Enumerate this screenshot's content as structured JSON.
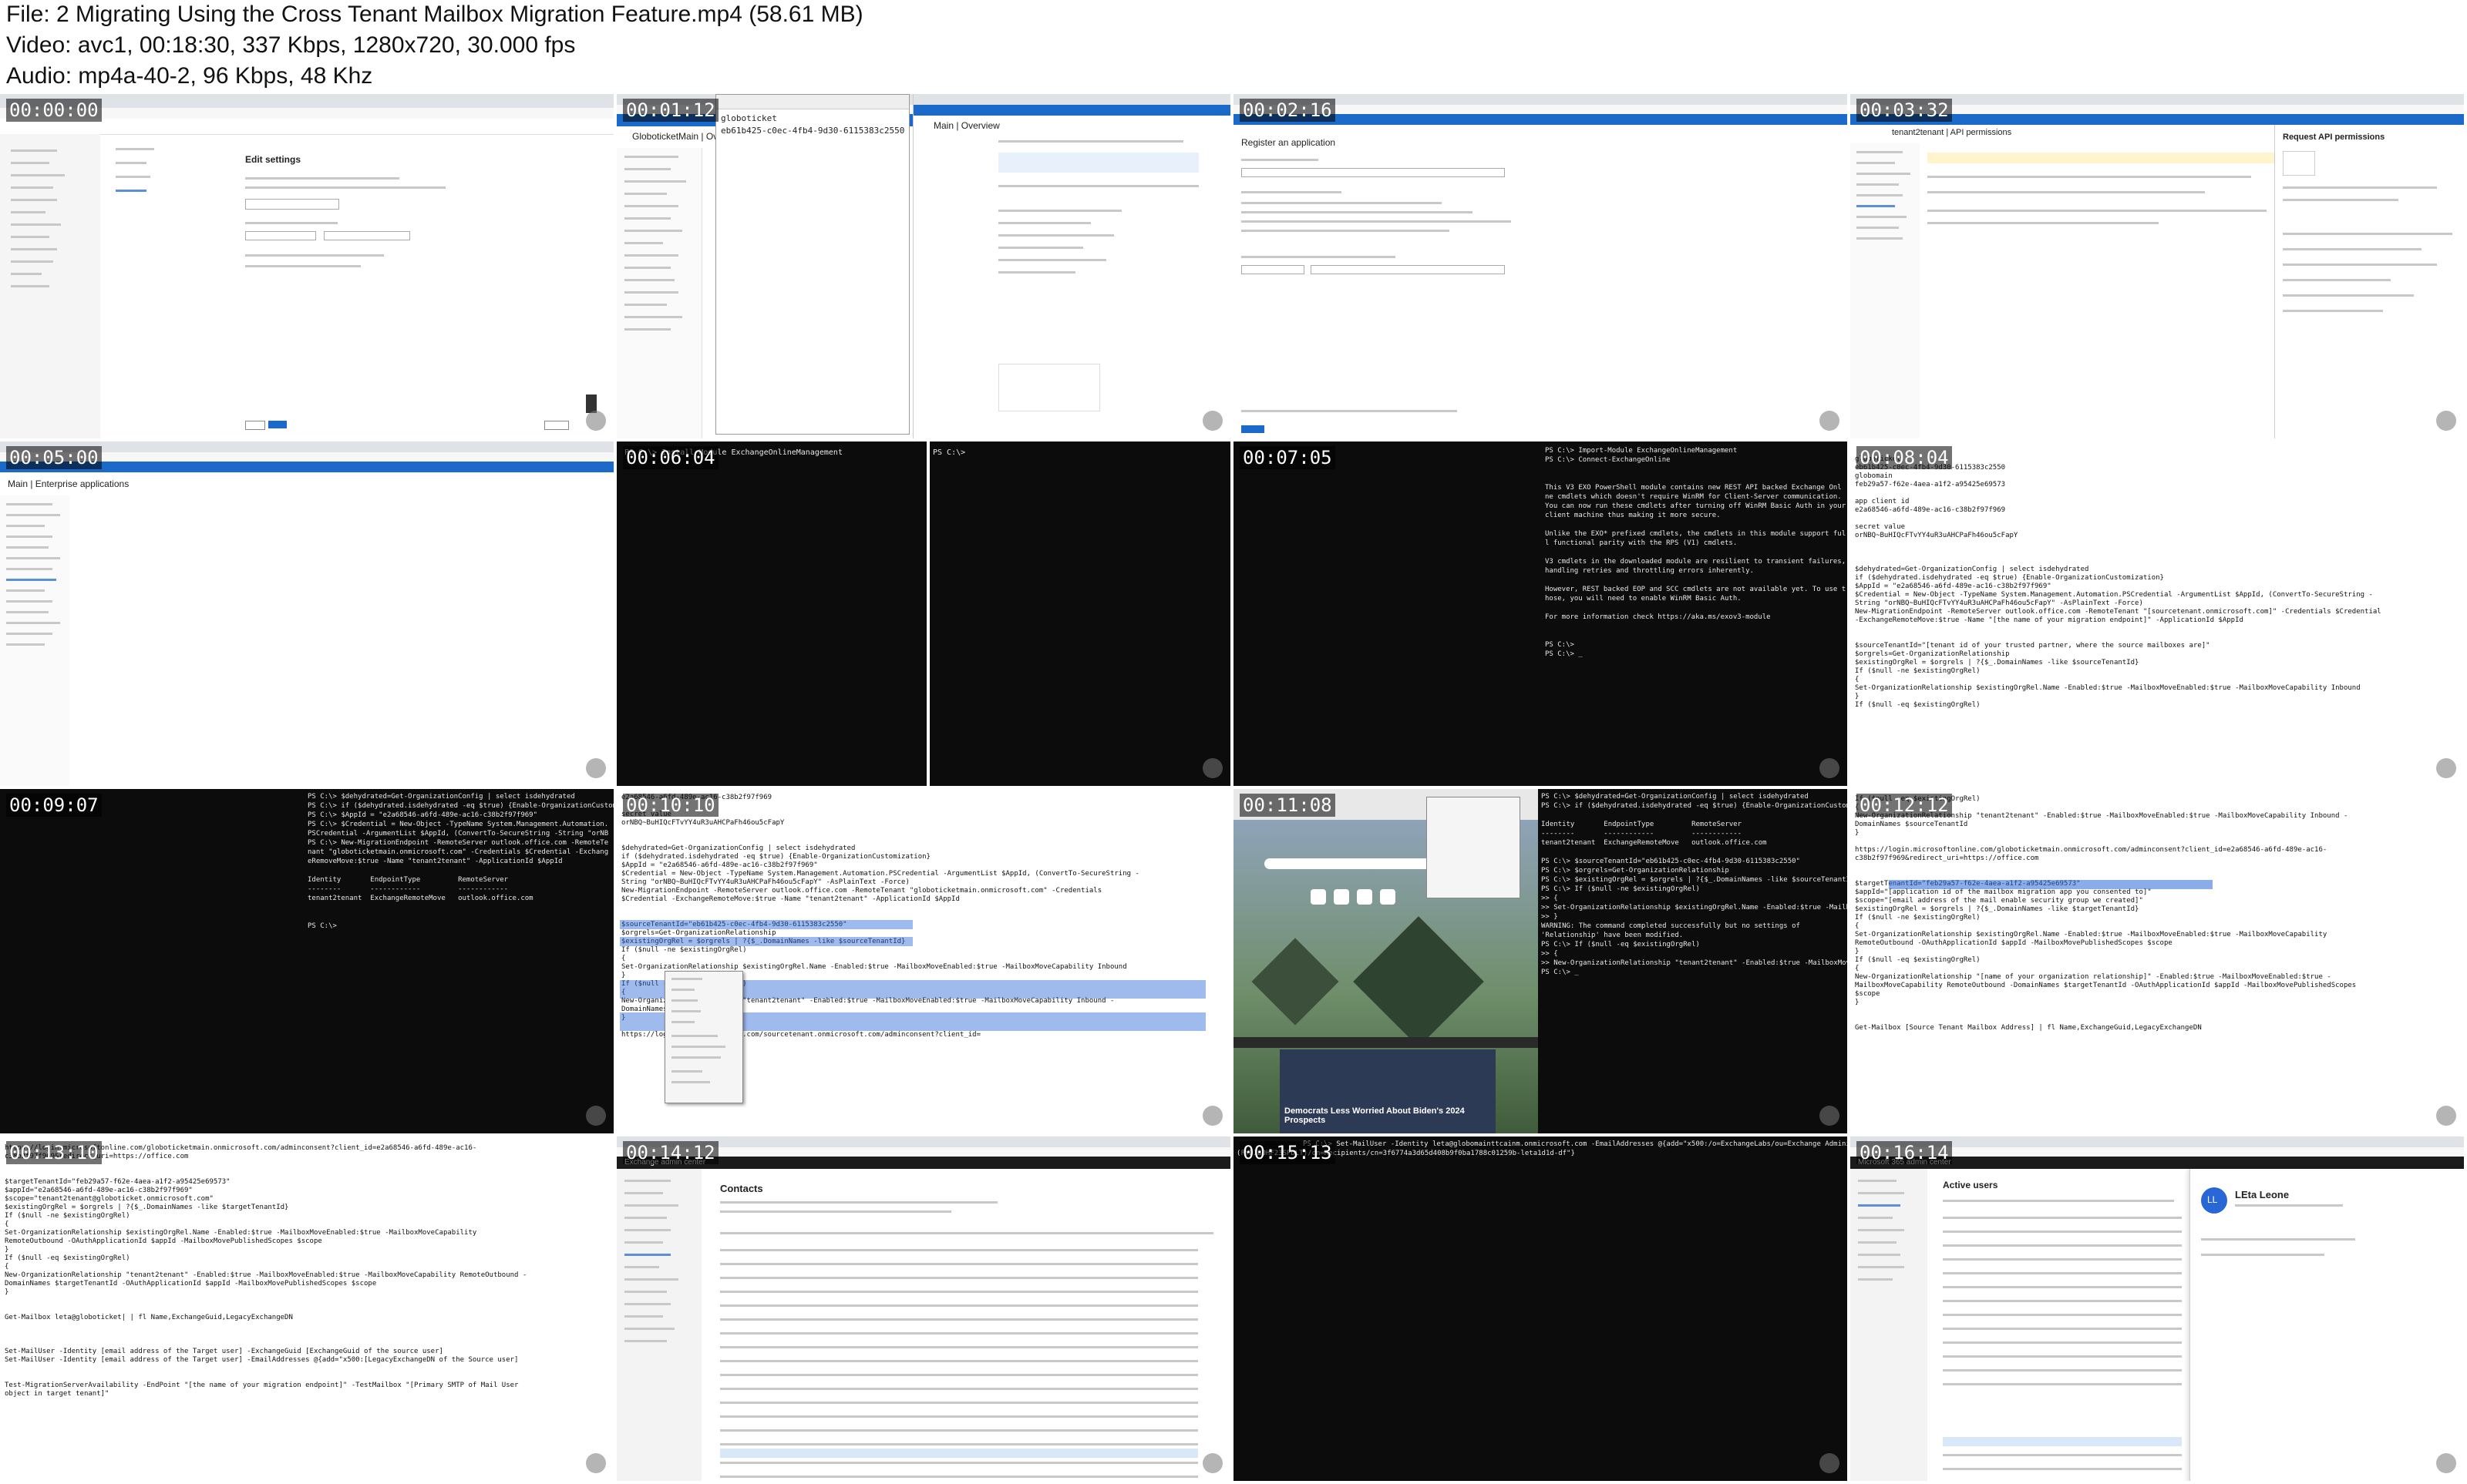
{
  "header": {
    "file_line": "File: 2  Migrating Using the Cross Tenant Mailbox Migration Feature.mp4 (58.61 MB)",
    "video_line": "Video: avc1, 00:18:30, 337 Kbps, 1280x720, 30.000 fps",
    "audio_line": "Audio: mp4a-40-2, 96 Kbps, 48 Khz"
  },
  "thumbnails": [
    {
      "time": "00:00:00"
    },
    {
      "time": "00:01:12"
    },
    {
      "time": "00:02:16"
    },
    {
      "time": "00:03:32"
    },
    {
      "time": "00:05:00"
    },
    {
      "time": "00:06:04"
    },
    {
      "time": "00:07:05"
    },
    {
      "time": "00:08:04"
    },
    {
      "time": "00:09:07"
    },
    {
      "time": "00:10:10"
    },
    {
      "time": "00:11:08"
    },
    {
      "time": "00:12:12"
    },
    {
      "time": "00:13:10"
    },
    {
      "time": "00:14:12"
    },
    {
      "time": "00:15:13"
    },
    {
      "time": "00:16:14"
    }
  ],
  "t1": {
    "page_title": "Edit settings"
  },
  "t2": {
    "app_name": "GloboticketMain | Ov",
    "notepad_title": "globoticket",
    "notepad_id": "eb61b425-c0ec-4fb4-9d30-6115383c2550",
    "overview_title": "Main | Overview"
  },
  "t3": {
    "page_title": "Register an application"
  },
  "t4": {
    "breadcrumb": "tenant2tenant | API permissions",
    "panel_title": "Request API permissions"
  },
  "t5": {
    "page_title": "Main | Enterprise applications"
  },
  "t6": {
    "cmd": "PS C:\\> Install-Module ExchangeOnlineManagement",
    "prompt": "PS C:\\>"
  },
  "t7": {
    "lines": [
      "PS C:\\> Import-Module ExchangeOnlineManagement",
      "PS C:\\> Connect-ExchangeOnline",
      "",
      "",
      "This V3 EXO PowerShell module contains new REST API backed Exchange Onl",
      "ne cmdlets which doesn't require WinRM for Client-Server communication.",
      "You can now run these cmdlets after turning off WinRM Basic Auth in your",
      "client machine thus making it more secure.",
      "",
      "Unlike the EXO* prefixed cmdlets, the cmdlets in this module support ful",
      "l functional parity with the RPS (V1) cmdlets.",
      "",
      "V3 cmdlets in the downloaded module are resilient to transient failures,",
      "handling retries and throttling errors inherently.",
      "",
      "However, REST backed EOP and SCC cmdlets are not available yet. To use t",
      "hose, you will need to enable WinRM Basic Auth.",
      "",
      "For more information check https://aka.ms/exov3-module",
      "",
      "",
      "PS C:\\>",
      "PS C:\\> _"
    ]
  },
  "t8": {
    "lines": [
      "globoticket",
      "eb61b425-c0ec-4fb4-9d30-6115383c2550",
      "globomain",
      "feb29a57-f62e-4aea-a1f2-a95425e69573",
      "",
      "app client id",
      "e2a68546-a6fd-489e-ac16-c38b2f97f969",
      "",
      "secret value",
      "orNBQ~BuHIQcFTvYY4uR3uAHCPaFh46ou5cFapY",
      "",
      "",
      "",
      "$dehydrated=Get-OrganizationConfig | select isdehydrated",
      "if ($dehydrated.isdehydrated -eq $true) {Enable-OrganizationCustomization}",
      "$AppId = \"e2a68546-a6fd-489e-ac16-c38b2f97f969\"",
      "$Credential = New-Object -TypeName System.Management.Automation.PSCredential -ArgumentList $AppId, (ConvertTo-SecureString -",
      "String \"orNBQ~BuHIQcFTvYY4uR3uAHCPaFh46ou5cFapY\" -AsPlainText -Force)",
      "New-MigrationEndpoint -RemoteServer outlook.office.com -RemoteTenant \"[sourcetenant.onmicrosoft.com]\" -Credentials $Credential",
      "-ExchangeRemoteMove:$true -Name \"[the name of your migration endpoint]\" -ApplicationId $AppId",
      "",
      "",
      "$sourceTenantId=\"[tenant id of your trusted partner, where the source mailboxes are]\"",
      "$orgrels=Get-OrganizationRelationship",
      "$existingOrgRel = $orgrels | ?{$_.DomainNames -like $sourceTenantId}",
      "If ($null -ne $existingOrgRel)",
      "{",
      "Set-OrganizationRelationship $existingOrgRel.Name -Enabled:$true -MailboxMoveEnabled:$true -MailboxMoveCapability Inbound",
      "}",
      "If ($null -eq $existingOrgRel)"
    ]
  },
  "t9": {
    "lines": [
      "PS C:\\> $dehydrated=Get-OrganizationConfig | select isdehydrated",
      "PS C:\\> if ($dehydrated.isdehydrated -eq $true) {Enable-OrganizationCustomization}",
      "PS C:\\> $AppId = \"e2a68546-a6fd-489e-ac16-c38b2f97f969\"",
      "PS C:\\> $Credential = New-Object -TypeName System.Management.Automation.",
      "PSCredential -ArgumentList $AppId, (ConvertTo-SecureString -String \"orNB",
      "PS C:\\> New-MigrationEndpoint -RemoteServer outlook.office.com -RemoteTe",
      "nant \"globoticketmain.onmicrosoft.com\" -Credentials $Credential -Exchang",
      "eRemoveMove:$true -Name \"tenant2tenant\" -ApplicationId $AppId",
      "",
      "Identity       EndpointType         RemoteServer",
      "--------       ------------         ------------",
      "tenant2tenant  ExchangeRemoteMove   outlook.office.com",
      "",
      "",
      "PS C:\\>"
    ]
  },
  "t10": {
    "lines": [
      "e2a68546-a6fd-489e-ac16-c38b2f97f969",
      "",
      "secret value",
      "orNBQ~BuHIQcFTvYY4uR3uAHCPaFh46ou5cFapY",
      "",
      "",
      "$dehydrated=Get-OrganizationConfig | select isdehydrated",
      "if ($dehydrated.isdehydrated -eq $true) {Enable-OrganizationCustomization}",
      "$AppId = \"e2a68546-a6fd-489e-ac16-c38b2f97f969\"",
      "$Credential = New-Object -TypeName System.Management.Automation.PSCredential -ArgumentList $AppId, (ConvertTo-SecureString -",
      "String \"orNBQ~BuHIQcFTvYY4uR3uAHCPaFh46ou5cFapY\" -AsPlainText -Force)",
      "New-MigrationEndpoint -RemoteServer outlook.office.com -RemoteTenant \"globoticketmain.onmicrosoft.com\" -Credentials",
      "$Credential -ExchangeRemoteMove:$true -Name \"tenant2tenant\" -ApplicationId $AppId",
      "",
      "",
      "$sourceTenantId=\"eb61b425-c0ec-4fb4-9d30-6115383c2550\"",
      "$orgrels=Get-OrganizationRelationship",
      "$existingOrgRel = $orgrels | ?{$_.DomainNames -like $sourceTenantId}",
      "If ($null -ne $existingOrgRel)",
      "{",
      "Set-OrganizationRelationship $existingOrgRel.Name -Enabled:$true -MailboxMoveEnabled:$true -MailboxMoveCapability Inbound",
      "}",
      "If ($null -eq $existingOrgRel)",
      "{",
      "New-OrganizationRelationship \"tenant2tenant\" -Enabled:$true -MailboxMoveEnabled:$true -MailboxMoveCapability Inbound -",
      "DomainNames $sourceTenantId",
      "}",
      "",
      "https://login.microsoftonline.com/sourcetenant.onmicrosoft.com/adminconsent?client_id="
    ]
  },
  "t11": {
    "news_headline": "Democrats Less Worried About Biden's 2024 Prospects",
    "lines": [
      "PS C:\\> $dehydrated=Get-OrganizationConfig | select isdehydrated",
      "PS C:\\> if ($dehydrated.isdehydrated -eq $true) {Enable-OrganizationCustomization}",
      "",
      "Identity       EndpointType         RemoteServer",
      "--------       ------------         ------------",
      "tenant2tenant  ExchangeRemoteMove   outlook.office.com",
      "",
      "PS C:\\> $sourceTenantId=\"eb61b425-c0ec-4fb4-9d30-6115383c2550\"",
      "PS C:\\> $orgrels=Get-OrganizationRelationship",
      "PS C:\\> $existingOrgRel = $orgrels | ?{$_.DomainNames -like $sourceTenantId}",
      "PS C:\\> If ($null -ne $existingOrgRel)",
      ">> {",
      ">> Set-OrganizationRelationship $existingOrgRel.Name -Enabled:$true -MailboxMove",
      ">> }",
      "WARNING: The command completed successfully but no settings of",
      "'Relationship' have been modified.",
      "PS C:\\> If ($null -eq $existingOrgRel)",
      ">> {",
      ">> New-OrganizationRelationship \"tenant2tenant\" -Enabled:$true -MailboxMove",
      "PS C:\\> _"
    ]
  },
  "t12": {
    "lines": [
      "If ($null -eq $existingOrgRel)",
      "{",
      "New-OrganizationRelationship \"tenant2tenant\" -Enabled:$true -MailboxMoveEnabled:$true -MailboxMoveCapability Inbound -",
      "DomainNames $sourceTenantId",
      "}",
      "",
      "https://login.microsoftonline.com/globoticketmain.onmicrosoft.com/adminconsent?client_id=e2a68546-a6fd-489e-ac16-",
      "c38b2f97f969&redirect_uri=https://office.com",
      "",
      "",
      "$targetTenantId=\"feb29a57-f62e-4aea-a1f2-a95425e69573\"",
      "$appId=\"[application id of the mailbox migration app you consented to]\"",
      "$scope=\"[email address of the mail enable security group we created]\"",
      "$existingOrgRel = $orgrels | ?{$_.DomainNames -like $targetTenantId}",
      "If ($null -ne $existingOrgRel)",
      "{",
      "Set-OrganizationRelationship $existingOrgRel.Name -Enabled:$true -MailboxMoveEnabled:$true -MailboxMoveCapability",
      "RemoteOutbound -OAuthApplicationId $appId -MailboxMovePublishedScopes $scope",
      "}",
      "If ($null -eq $existingOrgRel)",
      "{",
      "New-OrganizationRelationship \"[name of your organization relationship]\" -Enabled:$true -MailboxMoveEnabled:$true -",
      "MailboxMoveCapability RemoteOutbound -DomainNames $targetTenantId -OAuthApplicationId $appId -MailboxMovePublishedScopes",
      "$scope",
      "}",
      "",
      "",
      "Get-Mailbox [Source Tenant Mailbox Address] | fl Name,ExchangeGuid,LegacyExchangeDN"
    ]
  },
  "t13": {
    "lines": [
      "https://login.microsoftonline.com/globoticketmain.onmicrosoft.com/adminconsent?client_id=e2a68546-a6fd-489e-ac16-",
      "c38b2f97f969&redirect_uri=https://office.com",
      "",
      "",
      "$targetTenantId=\"feb29a57-f62e-4aea-a1f2-a95425e69573\"",
      "$appId=\"e2a68546-a6fd-489e-ac16-c38b2f97f969\"",
      "$scope=\"tenant2tenant@globoticket.onmicrosoft.com\"",
      "$existingOrgRel = $orgrels | ?{$_.DomainNames -like $targetTenantId}",
      "If ($null -ne $existingOrgRel)",
      "{",
      "Set-OrganizationRelationship $existingOrgRel.Name -Enabled:$true -MailboxMoveEnabled:$true -MailboxMoveCapability",
      "RemoteOutbound -OAuthApplicationId $appId -MailboxMovePublishedScopes $scope",
      "}",
      "If ($null -eq $existingOrgRel)",
      "{",
      "New-OrganizationRelationship \"tenant2tenant\" -Enabled:$true -MailboxMoveEnabled:$true -MailboxMoveCapability RemoteOutbound -",
      "DomainNames $targetTenantId -OAuthApplicationId $appId -MailboxMovePublishedScopes $scope",
      "}",
      "",
      "",
      "Get-Mailbox leta@globoticket| | fl Name,ExchangeGuid,LegacyExchangeDN",
      "",
      "",
      "",
      "Set-MailUser -Identity [email address of the Target user] -ExchangeGuid [ExchangeGuid of the source user]",
      "Set-MailUser -Identity [email address of the Target user] -EmailAddresses @{add=\"x500:[LegacyExchangeDN of the Source user]",
      "",
      "",
      "Test-MigrationServerAvailability -EndPoint \"[the name of your migration endpoint]\" -TestMailbox \"[Primary SMTP of Mail User",
      "object in target tenant]\""
    ]
  },
  "t14": {
    "brand": "Exchange admin center",
    "page_title": "Contacts"
  },
  "t15": {
    "line1": "PS C:\\> Set-MailUser -Identity leta@globomainttcainm.onmicrosoft.com -EmailAddresses @{add=\"x500:/o=ExchangeLabs/ou=Exchange Administrative Group",
    "line2": "(FYDIBOHF23SPDLT)/cn=Recipients/cn=3f6774a3d65d408b9f0ba1788c01259b-leta1d1d-df\"}"
  },
  "t16": {
    "brand": "Microsoft 365 admin center",
    "page_title": "Active users",
    "user_initials": "LL",
    "user_name": "LEta Leone"
  }
}
